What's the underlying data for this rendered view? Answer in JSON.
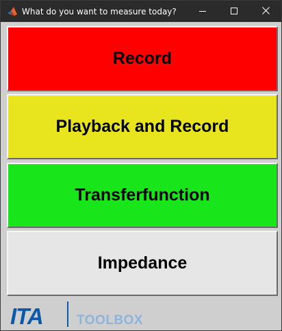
{
  "window": {
    "title": "What do you want to measure today?",
    "app_icon": "matlab-logo-icon",
    "controls": {
      "minimize_icon": "minimize-icon",
      "maximize_icon": "maximize-icon",
      "close_icon": "close-icon"
    }
  },
  "buttons": [
    {
      "label": "Record",
      "color": "#ff0000"
    },
    {
      "label": "Playback and Record",
      "color": "#e8e51e"
    },
    {
      "label": "Transferfunction",
      "color": "#19e61a"
    },
    {
      "label": "Impedance",
      "color": "#e6e6e6"
    }
  ],
  "logo": {
    "brand": "ITA",
    "product": "TOOLBOX",
    "brand_color": "#0a5aa8",
    "product_color": "#8db4dc",
    "divider_color": "#0a5aa8"
  },
  "colors": {
    "titlebar": "#2b2b2b",
    "content_background": "#cfcfcf"
  }
}
